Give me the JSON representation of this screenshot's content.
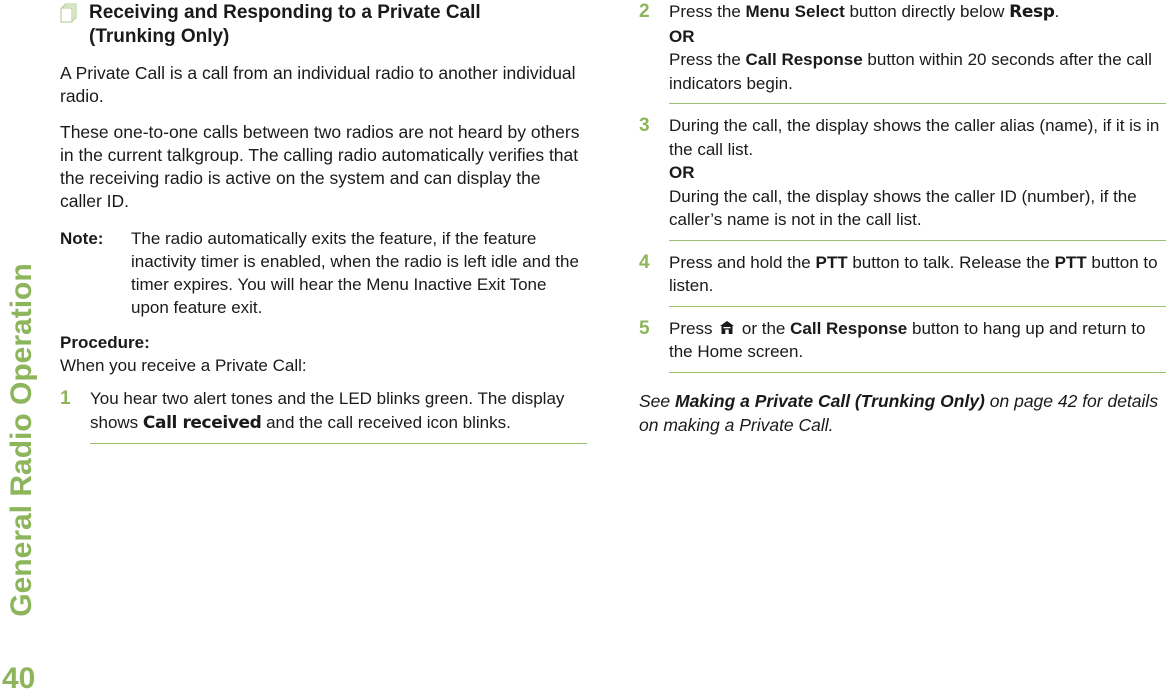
{
  "sidebar": {
    "section_title": "General Radio Operation",
    "page_number": "40"
  },
  "left": {
    "heading": {
      "icon": "document-stack-icon",
      "line1": "Receiving and Responding to a Private Call",
      "line2": "(Trunking Only)"
    },
    "para1": "A Private Call is a call from an individual radio to another individual radio.",
    "para2": "These one-to-one calls between two radios are not heard by others in the current talkgroup. The calling radio automatically verifies that the receiving radio is active on the system and can display the caller ID.",
    "note": {
      "label": "Note:",
      "text": "The radio automatically exits the feature, if the feature inactivity timer is enabled, when the radio is left idle and the timer expires. You will hear the Menu Inactive Exit Tone upon feature exit."
    },
    "procedure_label": "Procedure:",
    "procedure_intro": "When you receive a Private Call:",
    "step1": {
      "num": "1",
      "pre": "You hear two alert tones and the LED blinks green. The display shows ",
      "lcd": "Call received",
      "post": " and the call received icon blinks."
    }
  },
  "right": {
    "step2": {
      "num": "2",
      "a_pre": "Press the ",
      "a_bold": "Menu Select",
      "a_mid": " button directly below ",
      "a_lcd": "Resp",
      "a_post": ".",
      "or": "OR",
      "b_pre": "Press the ",
      "b_bold": "Call Response",
      "b_post": " button within 20 seconds after the call indicators begin."
    },
    "step3": {
      "num": "3",
      "a": "During the call, the display shows the caller alias (name), if it is in the call list.",
      "or": "OR",
      "b": "During the call, the display shows the caller ID (number), if the caller’s name is not in the call list."
    },
    "step4": {
      "num": "4",
      "pre": "Press and hold the ",
      "bold1": "PTT",
      "mid": " button to talk. Release the ",
      "bold2": "PTT",
      "post": " button to listen."
    },
    "step5": {
      "num": "5",
      "pre": "Press ",
      "icon": "home-icon",
      "mid": " or the ",
      "bold": "Call Response",
      "post": " button to hang up and return to the Home screen."
    },
    "see": {
      "pre": "See ",
      "link": "Making a Private Call (Trunking Only)",
      "post": " on page 42 for details on making a Private Call."
    }
  },
  "colors": {
    "accent": "#8db55c",
    "rule": "#9cbf70",
    "text": "#1a1a1a"
  }
}
